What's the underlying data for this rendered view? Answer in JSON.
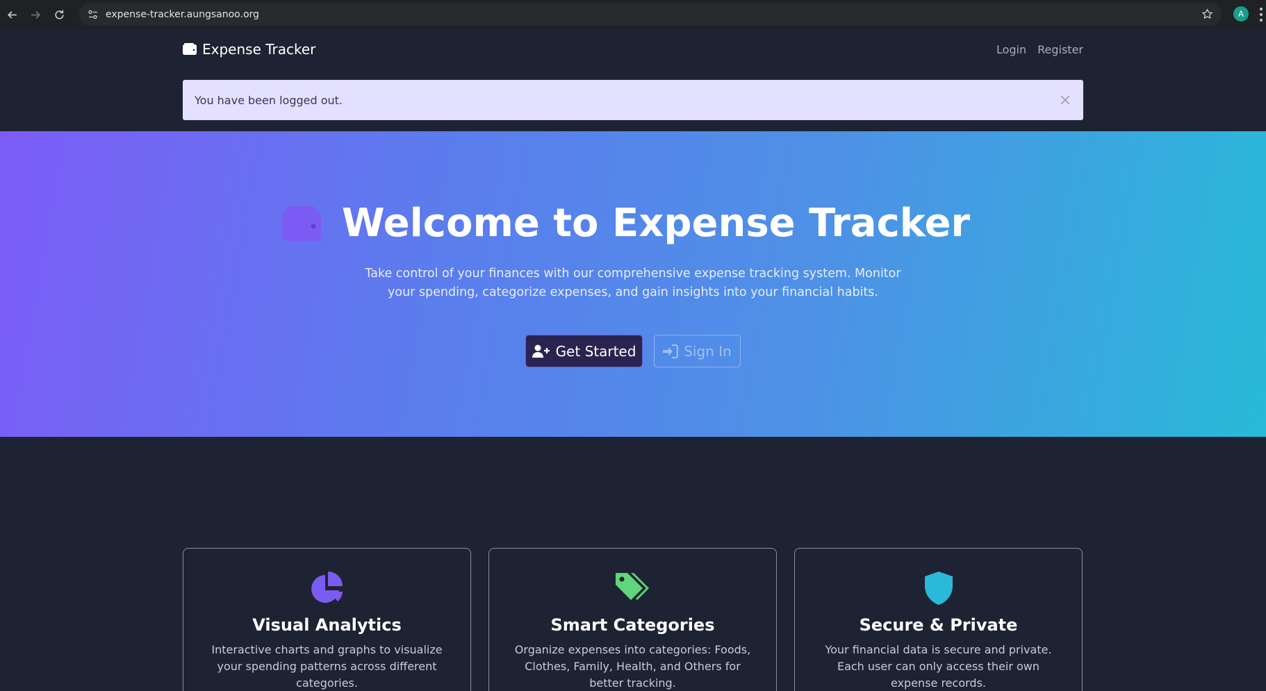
{
  "browser": {
    "url": "expense-tracker.aungsanoo.org",
    "profile_initial": "A"
  },
  "navbar": {
    "brand": "Expense Tracker",
    "links": [
      "Login",
      "Register"
    ]
  },
  "alert": {
    "message": "You have been logged out."
  },
  "hero": {
    "title": "Welcome to Expense Tracker",
    "subtitle": "Take control of your finances with our comprehensive expense tracking system. Monitor your spending, categorize expenses, and gain insights into your financial habits.",
    "primary_button": "Get Started",
    "secondary_button": "Sign In"
  },
  "features": [
    {
      "icon": "chart-pie-icon",
      "title": "Visual Analytics",
      "text": "Interactive charts and graphs to visualize your spending patterns across different categories."
    },
    {
      "icon": "tags-icon",
      "title": "Smart Categories",
      "text": "Organize expenses into categories: Foods, Clothes, Family, Health, and Others for better tracking."
    },
    {
      "icon": "shield-icon",
      "title": "Secure & Private",
      "text": "Your financial data is secure and private. Each user can only access their own expense records."
    }
  ],
  "colors": {
    "page_bg": "#1e2333",
    "gradient_start": "#7c5cf7",
    "gradient_end": "#28bad8",
    "alert_bg": "#e4e0ff",
    "icon_purple": "#7b5cf0",
    "icon_green": "#5fd67a",
    "icon_cyan": "#28bad8"
  }
}
